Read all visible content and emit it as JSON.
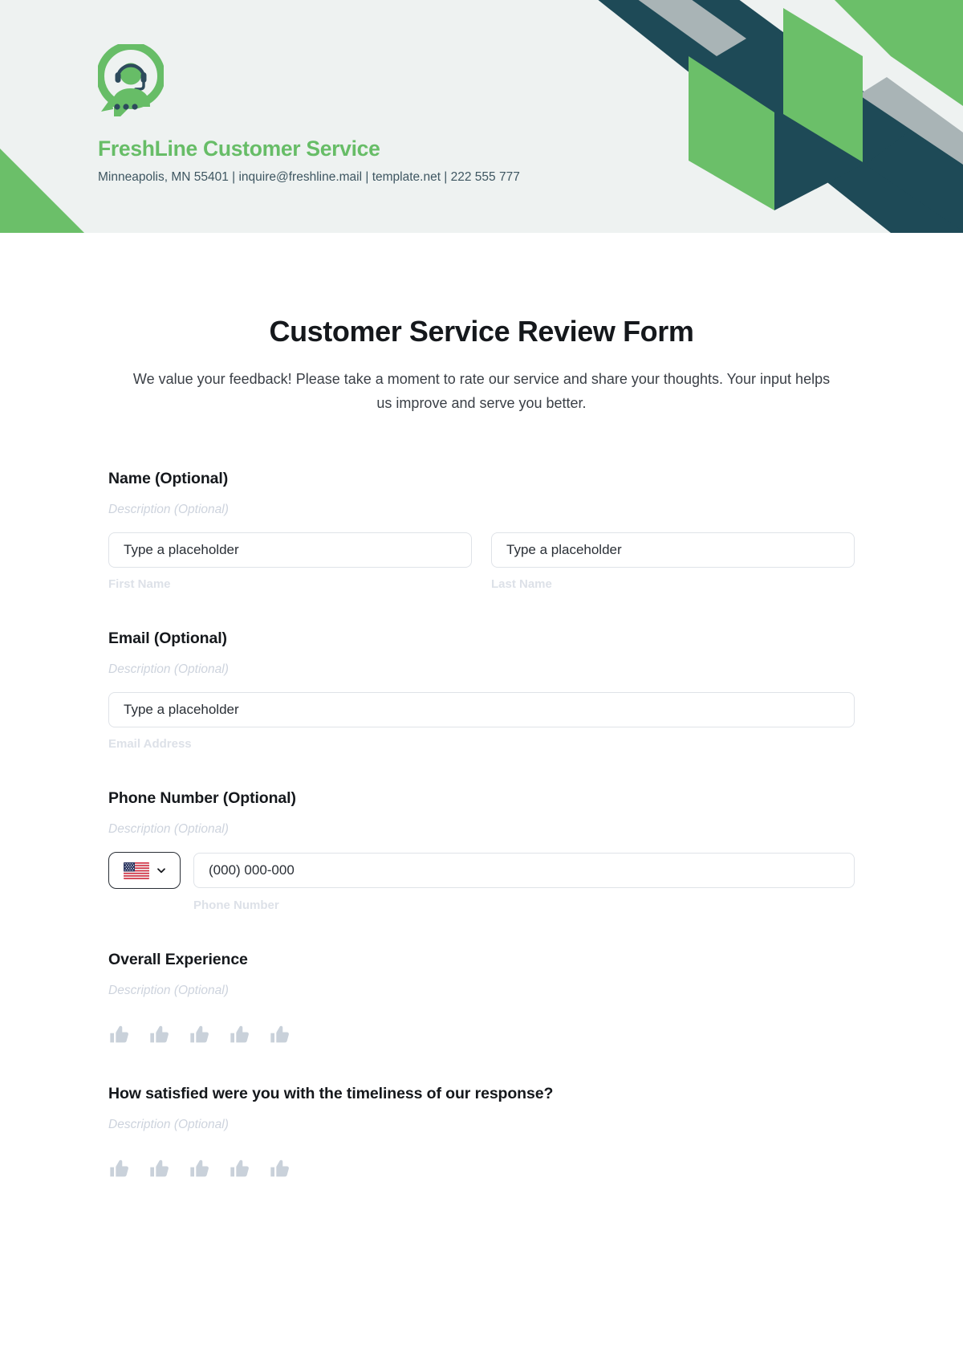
{
  "header": {
    "logo_icon": "customer-service-headset-logo",
    "brand_name": "FreshLine Customer Service",
    "contact_line": "Minneapolis, MN 55401 | inquire@freshline.mail | template.net | 222 555 777",
    "accent_green": "#6bbf69",
    "accent_dark": "#1e4a57",
    "accent_gray": "#a9b4b6",
    "background": "#eef2f1"
  },
  "form": {
    "title": "Customer Service Review Form",
    "subtitle": "We value your feedback! Please take a moment to rate our service and share your thoughts. Your input helps us improve and serve you better.",
    "fields": [
      {
        "label": "Name (Optional)",
        "description": "Description (Optional)",
        "inputs": [
          {
            "placeholder": "Type a placeholder",
            "sublabel": "First Name"
          },
          {
            "placeholder": "Type a placeholder",
            "sublabel": "Last Name"
          }
        ]
      },
      {
        "label": "Email (Optional)",
        "description": "Description (Optional)",
        "inputs": [
          {
            "placeholder": "Type a placeholder",
            "sublabel": "Email Address"
          }
        ]
      },
      {
        "label": "Phone Number (Optional)",
        "description": "Description (Optional)",
        "country_flag": "us-flag-icon",
        "dropdown_icon": "chevron-down-icon",
        "placeholder": "(000) 000-000",
        "sublabel": "Phone Number"
      },
      {
        "label": "Overall Experience",
        "description": "Description (Optional)",
        "rating_icon": "thumbs-up-icon",
        "rating_count": 5,
        "rating_value": 0
      },
      {
        "label": "How satisfied were you with the timeliness of our response?",
        "description": "Description (Optional)",
        "rating_icon": "thumbs-up-icon",
        "rating_count": 5,
        "rating_value": 0
      }
    ]
  }
}
